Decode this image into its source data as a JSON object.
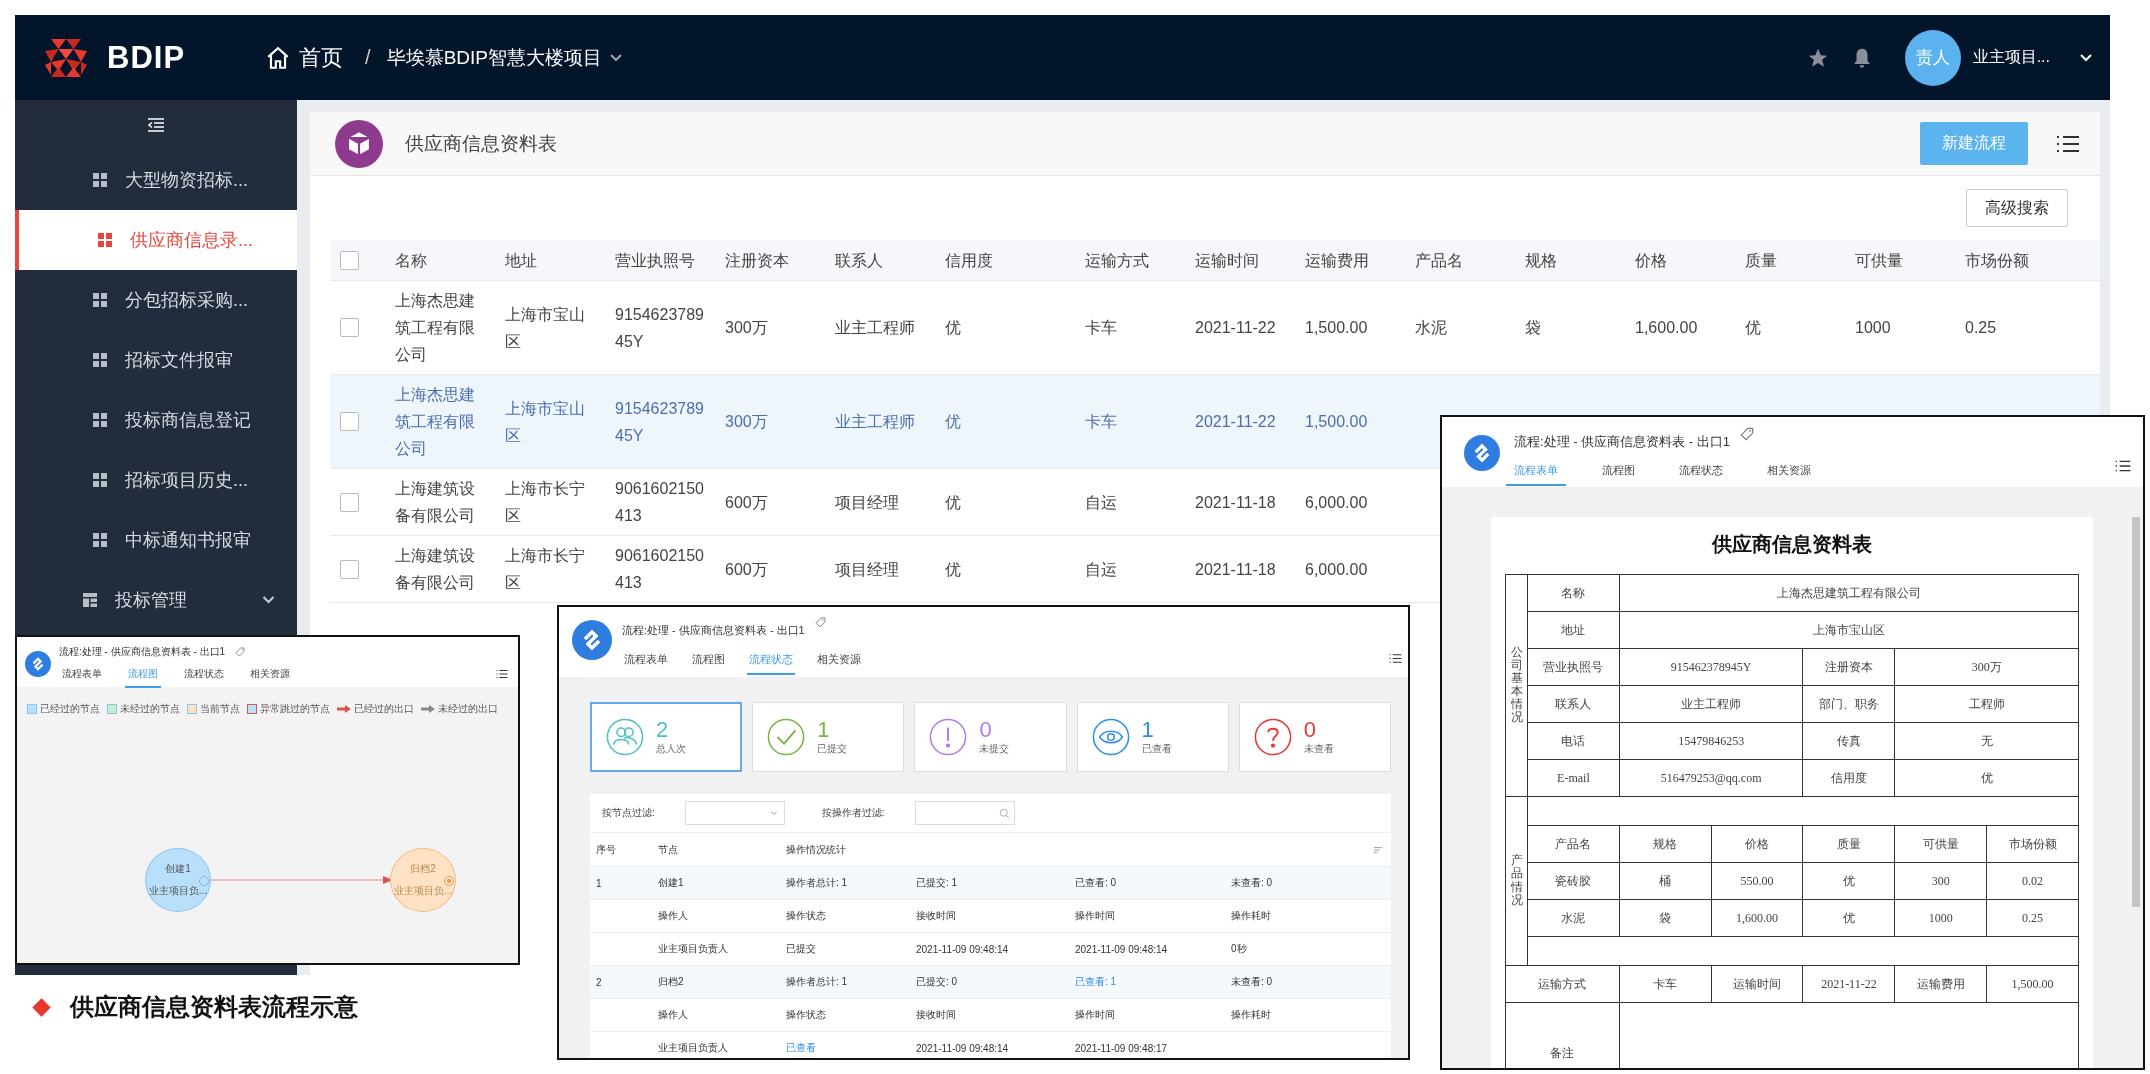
{
  "header": {
    "brand": "BDIP",
    "home": "首页",
    "separator": "/",
    "project": "毕埃慕BDIP智慧大楼项目",
    "avatar": "责人",
    "user": "业主项目..."
  },
  "sidebar": {
    "items": [
      {
        "label": "大型物资招标...",
        "kind": "page",
        "selected": false
      },
      {
        "label": "供应商信息录...",
        "kind": "page",
        "selected": true
      },
      {
        "label": "分包招标采购...",
        "kind": "page",
        "selected": false
      },
      {
        "label": "招标文件报审",
        "kind": "page",
        "selected": false
      },
      {
        "label": "投标商信息登记",
        "kind": "page",
        "selected": false
      },
      {
        "label": "招标项目历史...",
        "kind": "page",
        "selected": false
      },
      {
        "label": "中标通知书报审",
        "kind": "page",
        "selected": false
      },
      {
        "label": "投标管理",
        "kind": "group",
        "selected": false
      }
    ]
  },
  "page": {
    "title": "供应商信息资料表",
    "new_button": "新建流程",
    "search_button": "高级搜索"
  },
  "table": {
    "all_checked": false,
    "columns": [
      {
        "label": "名称"
      },
      {
        "label": "地址"
      },
      {
        "label": "营业执照号"
      },
      {
        "label": "注册资本"
      },
      {
        "label": "联系人"
      },
      {
        "label": "信用度"
      },
      {
        "label": "运输方式"
      },
      {
        "label": "运输时间"
      },
      {
        "label": "运输费用"
      },
      {
        "label": "产品名"
      },
      {
        "label": "规格"
      },
      {
        "label": "价格"
      },
      {
        "label": "质量"
      },
      {
        "label": "可供量"
      },
      {
        "label": "市场份额"
      }
    ],
    "rows": [
      {
        "checked": false,
        "hovered": false,
        "cells": [
          "上海杰思建筑工程有限公司",
          "上海市宝山区",
          "915462378945Y",
          "300万",
          "业主工程师",
          "优",
          "卡车",
          "2021-11-22",
          "1,500.00",
          "水泥",
          "袋",
          "1,600.00",
          "优",
          "1000",
          "0.25"
        ]
      },
      {
        "checked": false,
        "hovered": true,
        "cells": [
          "上海杰思建筑工程有限公司",
          "上海市宝山区",
          "915462378945Y",
          "300万",
          "业主工程师",
          "优",
          "卡车",
          "2021-11-22",
          "1,500.00"
        ]
      },
      {
        "checked": false,
        "hovered": false,
        "cells": [
          "上海建筑设备有限公司",
          "上海市长宁区",
          "9061602150413",
          "600万",
          "项目经理",
          "优",
          "自运",
          "2021-11-18",
          "6,000.00"
        ]
      },
      {
        "checked": false,
        "hovered": false,
        "cells": [
          "上海建筑设备有限公司",
          "上海市长宁区",
          "9061602150413",
          "600万",
          "项目经理",
          "优",
          "自运",
          "2021-11-18",
          "6,000.00"
        ]
      }
    ]
  },
  "flow_chart_window": {
    "title": "流程:处理 - 供应商信息资料表 - 出口1",
    "tabs": [
      {
        "label": "流程表单",
        "selected": false
      },
      {
        "label": "流程图",
        "selected": true
      },
      {
        "label": "流程状态",
        "selected": false
      },
      {
        "label": "相关资源",
        "selected": false
      }
    ],
    "legend": [
      {
        "label": "已经过的节点",
        "kind": "node",
        "color": "#b9e0fb"
      },
      {
        "label": "未经过的节点",
        "kind": "node",
        "color": "#c8eecb"
      },
      {
        "label": "当前节点",
        "kind": "node",
        "color": "#fde2c4"
      },
      {
        "label": "异常跳过的节点",
        "kind": "skipped-node",
        "color": "#b9e0fb"
      },
      {
        "label": "已经过的出口",
        "kind": "exit",
        "color": "#d9534f"
      },
      {
        "label": "未经过的出口",
        "kind": "exit",
        "color": "#888888"
      }
    ],
    "nodes": [
      {
        "name": "创建1",
        "owner": "业主项目负...",
        "kind": "start",
        "color": "#b9e0fb"
      },
      {
        "name": "归档2",
        "owner": "业主项目负...",
        "kind": "end",
        "color": "#fde2c4"
      }
    ]
  },
  "status_window": {
    "title": "流程:处理 - 供应商信息资料表 - 出口1",
    "tabs": [
      {
        "label": "流程表单",
        "selected": false
      },
      {
        "label": "流程图",
        "selected": false
      },
      {
        "label": "流程状态",
        "selected": true
      },
      {
        "label": "相关资源",
        "selected": false
      }
    ],
    "stats": [
      {
        "value": "2",
        "label": "总人次",
        "kind": "people",
        "color": "#4fbfc9",
        "selected": true
      },
      {
        "value": "1",
        "label": "已提交",
        "kind": "check",
        "color": "#7cb342",
        "selected": false
      },
      {
        "value": "0",
        "label": "未提交",
        "kind": "exclaim",
        "color": "#b07ee6",
        "selected": false
      },
      {
        "value": "1",
        "label": "已查看",
        "kind": "eye",
        "color": "#2e8ded",
        "selected": false
      },
      {
        "value": "0",
        "label": "未查看",
        "kind": "question",
        "color": "#e53935",
        "selected": false
      }
    ],
    "node_filter": "按节点过滤:",
    "operator_filter": "按操作者过滤:",
    "columns": [
      "序号",
      "节点",
      "操作情况统计"
    ],
    "rows": [
      {
        "kind": "node",
        "cells": [
          {
            "text": "1",
            "linked": false
          },
          {
            "text": "创建1",
            "linked": false
          },
          {
            "text": "操作者总计: 1",
            "linked": false
          },
          {
            "text": "已提交: 1",
            "linked": false
          },
          {
            "text": "已查看: 0",
            "linked": false
          },
          {
            "text": "未查看: 0",
            "linked": false
          }
        ]
      },
      {
        "kind": "detail",
        "cells": [
          {
            "text": "操作人",
            "linked": false
          },
          {
            "text": "操作状态",
            "linked": false
          },
          {
            "text": "接收时间",
            "linked": false
          },
          {
            "text": "操作时间",
            "linked": false
          },
          {
            "text": "操作耗时",
            "linked": false
          }
        ]
      },
      {
        "kind": "detail",
        "cells": [
          {
            "text": "业主项目负责人",
            "linked": false
          },
          {
            "text": "已提交",
            "linked": false
          },
          {
            "text": "2021-11-09 09:48:14",
            "linked": false
          },
          {
            "text": "2021-11-09 09:48:14",
            "linked": false
          },
          {
            "text": "0秒",
            "linked": false
          }
        ]
      },
      {
        "kind": "node",
        "cells": [
          {
            "text": "2",
            "linked": false
          },
          {
            "text": "归档2",
            "linked": false
          },
          {
            "text": "操作者总计: 1",
            "linked": false
          },
          {
            "text": "已提交: 0",
            "linked": false
          },
          {
            "text": "已查看: 1",
            "linked": true
          },
          {
            "text": "未查看: 0",
            "linked": false
          }
        ]
      },
      {
        "kind": "detail",
        "cells": [
          {
            "text": "操作人",
            "linked": false
          },
          {
            "text": "操作状态",
            "linked": false
          },
          {
            "text": "接收时间",
            "linked": false
          },
          {
            "text": "操作时间",
            "linked": false
          },
          {
            "text": "操作耗时",
            "linked": false
          }
        ]
      },
      {
        "kind": "detail",
        "cells": [
          {
            "text": "业主项目负责人",
            "linked": false
          },
          {
            "text": "已查看",
            "linked": true
          },
          {
            "text": "2021-11-09 09:48:14",
            "linked": false
          },
          {
            "text": "2021-11-09 09:48:17",
            "linked": false
          }
        ]
      }
    ]
  },
  "form_window": {
    "title": "流程:处理 - 供应商信息资料表 - 出口1",
    "tabs": [
      {
        "label": "流程表单",
        "selected": true
      },
      {
        "label": "流程图",
        "selected": false
      },
      {
        "label": "流程状态",
        "selected": false
      },
      {
        "label": "相关资源",
        "selected": false
      }
    ],
    "form": {
      "title": "供应商信息资料表",
      "company_section": {
        "label": "公司基本情况",
        "rows": [
          [
            {
              "text": "名称"
            },
            {
              "text": "上海杰思建筑工程有限公司",
              "colspan": 5
            }
          ],
          [
            {
              "text": "地址"
            },
            {
              "text": "上海市宝山区",
              "colspan": 5
            }
          ],
          [
            {
              "text": "营业执照号"
            },
            {
              "text": "915462378945Y",
              "colspan": 2
            },
            {
              "text": "注册资本"
            },
            {
              "text": "300万",
              "colspan": 2
            }
          ],
          [
            {
              "text": "联系人"
            },
            {
              "text": "业主工程师",
              "colspan": 2
            },
            {
              "text": "部门、职务"
            },
            {
              "text": "工程师",
              "colspan": 2
            }
          ],
          [
            {
              "text": "电话"
            },
            {
              "text": "15479846253",
              "colspan": 2
            },
            {
              "text": "传真"
            },
            {
              "text": "无",
              "colspan": 2
            }
          ],
          [
            {
              "text": "E-mail"
            },
            {
              "text": "516479253@qq.com",
              "colspan": 2
            },
            {
              "text": "信用度"
            },
            {
              "text": "优",
              "colspan": 2
            }
          ]
        ]
      },
      "product_section": {
        "label": "产品情况",
        "columns": [
          "产品名",
          "规格",
          "价格",
          "质量",
          "可供量",
          "市场份额"
        ],
        "rows": [
          [
            "瓷砖胶",
            "桶",
            "550.00",
            "优",
            "300",
            "0.02"
          ],
          [
            "水泥",
            "袋",
            "1,600.00",
            "优",
            "1000",
            "0.25"
          ]
        ]
      },
      "transport": [
        {
          "text": "运输方式",
          "colspan": 2
        },
        {
          "text": "卡车"
        },
        {
          "text": "运输时间"
        },
        {
          "text": "2021-11-22"
        },
        {
          "text": "运输费用"
        },
        {
          "text": "1,500.00"
        }
      ],
      "remarks": {
        "text": "备注",
        "colspan": 2
      }
    }
  },
  "caption": "供应商信息资料表流程示意"
}
